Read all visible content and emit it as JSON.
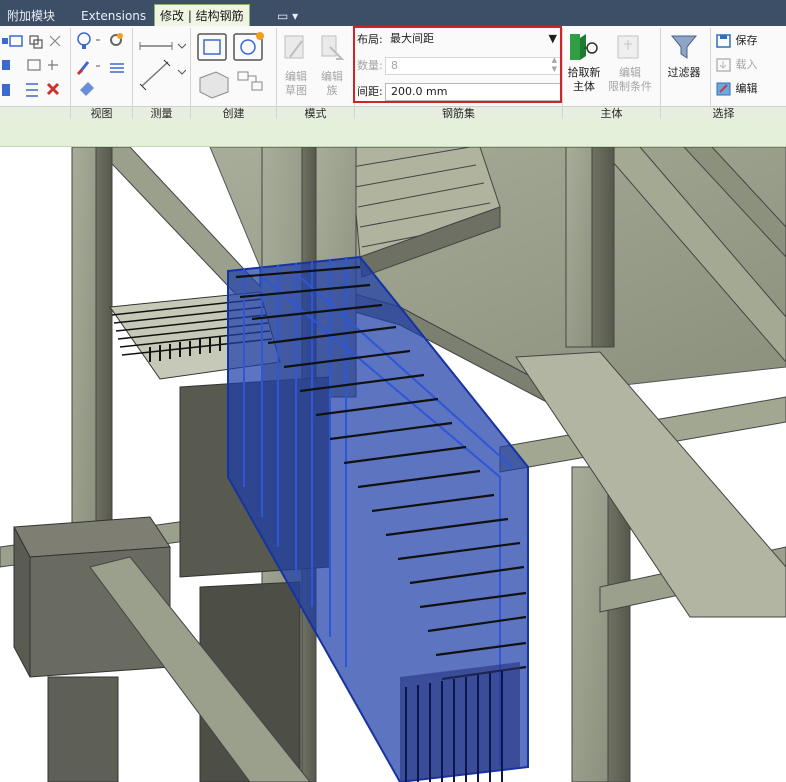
{
  "tabs": [
    {
      "label": "附加模块",
      "active": false
    },
    {
      "label": "Extensions",
      "active": false
    },
    {
      "label": "修改 | 结构钢筋",
      "active": true
    },
    {
      "label": "▭ ▾",
      "active": false
    }
  ],
  "panels": {
    "view": "视图",
    "measure": "测量",
    "create": "创建",
    "mode": "模式",
    "rebar_set": "钢筋集",
    "host": "主体",
    "select": "选择"
  },
  "mode_tools": {
    "edit_sketch": [
      "编辑",
      "草图"
    ],
    "edit_family": [
      "编辑",
      "族"
    ]
  },
  "rebar_set": {
    "layout_label": "布局:",
    "layout_value": "最大间距",
    "quantity_label": "数量:",
    "quantity_value": "8",
    "spacing_label": "间距:",
    "spacing_value": "200.0 mm"
  },
  "host_tools": {
    "pick_new_host": [
      "拾取新",
      "主体"
    ],
    "edit_constraints": [
      "编辑",
      "限制条件"
    ]
  },
  "select_tools": {
    "filter": "过滤器",
    "save": "保存",
    "load": "载入",
    "edit": "编辑"
  },
  "colors": {
    "tab_bar": "#3c4f66",
    "highlight": "#d2232a",
    "rebar_plane": "#1f3fa8",
    "concrete": "#9ba08e",
    "option_bar": "#e4f0d9"
  }
}
